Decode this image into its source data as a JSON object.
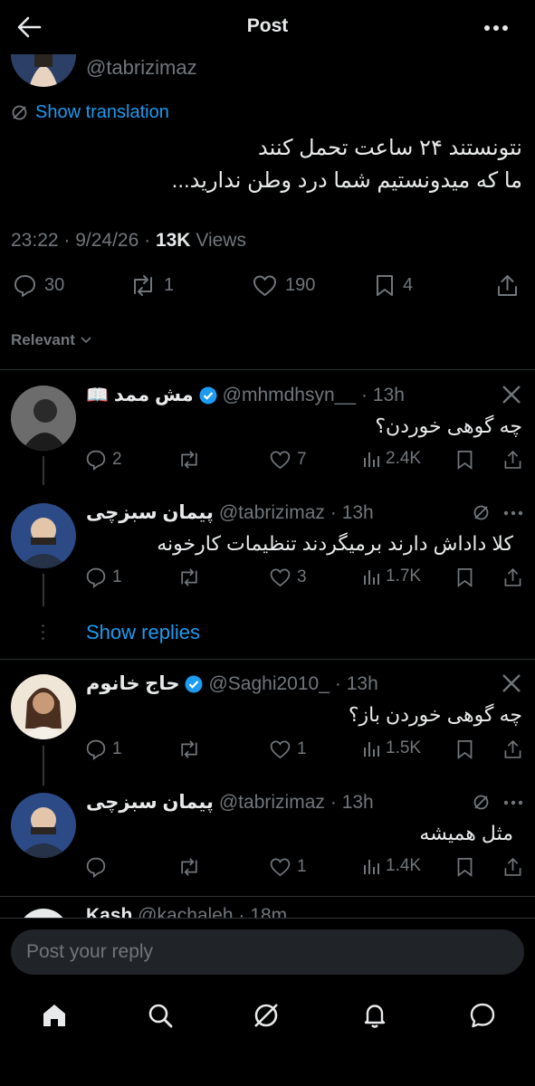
{
  "header": {
    "title": "Post"
  },
  "post": {
    "handle": "@tabrizimaz",
    "show_translation": "Show translation",
    "text_line1": "نتونستند ۲۴ ساعت تحمل کنند",
    "text_line2": "ما که میدونستیم شما درد وطن ندارید...",
    "time": "23:22 · 9/24/26 · ",
    "views_count": "13K",
    "views_label": " Views",
    "replies": "30",
    "reposts": "1",
    "likes": "190",
    "bookmarks": "4"
  },
  "sort": {
    "label": "Relevant"
  },
  "replies": [
    {
      "name": "مش ممد",
      "name_emoji": "📖",
      "handle": "@mhmdhsyn__",
      "time": "· 13h",
      "text": "چه گوهی خوردن؟",
      "replies": "2",
      "reposts": "",
      "likes": "7",
      "views": "2.4K"
    },
    {
      "name": "پیمان سبزچی",
      "handle": "@tabrizimaz",
      "time": "· 13h",
      "text": "کلا داداش دارند برمیگردند تنظیمات کارخونه",
      "replies": "1",
      "reposts": "",
      "likes": "3",
      "views": "1.7K"
    },
    {
      "name": "حاج خانوم",
      "handle": "@Saghi2010_",
      "time": "· 13h",
      "text": "چه گوهی خوردن باز؟",
      "replies": "1",
      "reposts": "",
      "likes": "1",
      "views": "1.5K"
    },
    {
      "name": "پیمان سبزچی",
      "handle": "@tabrizimaz",
      "time": "· 13h",
      "text": "مثل همیشه",
      "replies": "",
      "reposts": "",
      "likes": "1",
      "views": "1.4K"
    }
  ],
  "show_replies": "Show replies",
  "partial": {
    "name": "Kash",
    "handle": "@kachaleh",
    "time": "· 18m"
  },
  "composer": {
    "placeholder": "Post your reply"
  },
  "colors": {
    "accent": "#1d9bf0",
    "background": "#000000",
    "muted": "#71767b"
  }
}
